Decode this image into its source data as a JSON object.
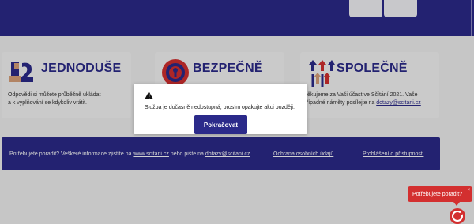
{
  "header": {
    "background_color": "#2b2a8a"
  },
  "cards": [
    {
      "title": "JEDNODUŠE",
      "icon": "easy-icon",
      "text_line1": "Odpovědi si můžete průběžně ukládat",
      "text_line2": "a k vyplňování se kdykoliv vrátit."
    },
    {
      "title": "BEZPEČNĚ",
      "icon": "lock-icon"
    },
    {
      "title": "SPOLEČNĚ",
      "icon": "arrows-icon",
      "text_line1": "Děkujeme za Vaši účast ve Sčítání 2021. Vaše",
      "text_line2_prefix": "případné náměty posílejte na ",
      "email": "dotazy@scitani.cz"
    }
  ],
  "dialog": {
    "icon": "warning-icon",
    "message": "Služba je dočasně nedostupná, prosím opakujte akci později.",
    "button_label": "Pokračovat"
  },
  "footer": {
    "text_prefix": "Potřebujete poradit? Veškeré informace zjistíte na ",
    "site_link": "www.scitani.cz",
    "text_middle": " nebo pište na ",
    "email_link": "dotazy@scitani.cz",
    "privacy_link": "Ochrana osobních údajů",
    "accessibility_link": "Prohlášení o přístupnosti"
  },
  "help_widget": {
    "label": "Potřebujete poradit?",
    "close": "×",
    "color": "#d32f2f"
  }
}
